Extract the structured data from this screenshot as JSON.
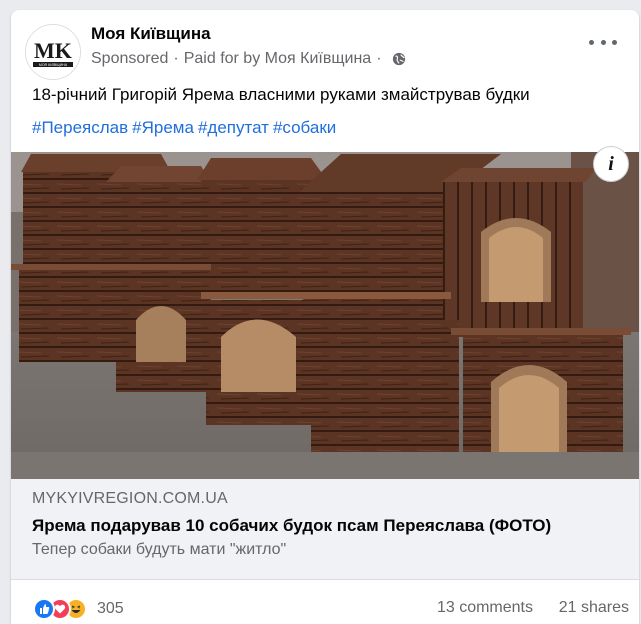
{
  "post": {
    "page_name": "Моя Київщина",
    "sponsored": "Sponsored",
    "paid_for": "Paid for by Моя Київщина",
    "text": "18-річний Григорій Ярема власними руками змайстрував будки",
    "hashtags": [
      "#Переяслав",
      "#Ярема",
      "#депутат",
      "#собаки"
    ],
    "avatar_text": "MK",
    "avatar_subtext": "МОЯ КИЇВЩИНА",
    "info_icon_glyph": "i"
  },
  "link": {
    "domain": "MYKYIVREGION.COM.UA",
    "title": "Ярема подарував 10 собачих будок псам Переяслава (ФОТО)",
    "description": "Тепер собаки будуть мати \"житло\""
  },
  "footer": {
    "reaction_count": "305",
    "comments": "13 comments",
    "shares": "21 shares",
    "reactions": [
      "like-icon",
      "love-icon",
      "haha-icon"
    ]
  },
  "colors": {
    "link_blue": "#216fdb",
    "like_blue": "#1877f2",
    "love_red": "#f33e58",
    "haha_yellow": "#f7b125"
  }
}
